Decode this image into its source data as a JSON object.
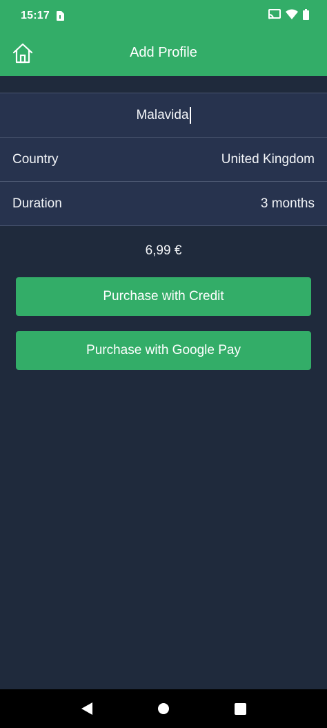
{
  "status_bar": {
    "time": "15:17",
    "icons": [
      "sim-card-icon",
      "cast-icon",
      "wifi-icon",
      "battery-icon"
    ]
  },
  "app_bar": {
    "title": "Add Profile",
    "home_icon": "home-icon",
    "background": "#33ad68"
  },
  "form": {
    "profile_name": "Malavida",
    "rows": [
      {
        "label": "Country",
        "value": "United Kingdom"
      },
      {
        "label": "Duration",
        "value": "3 months"
      }
    ]
  },
  "price": "6,99 €",
  "buttons": {
    "credit_label": "Purchase with Credit",
    "gpay_label": "Purchase with Google Pay"
  },
  "nav_bar": {
    "icons": [
      "back-icon",
      "home-circle-icon",
      "recents-icon"
    ]
  },
  "colors": {
    "accent": "#33ad68",
    "background": "#1f2a3c",
    "row_background": "#27334e"
  }
}
